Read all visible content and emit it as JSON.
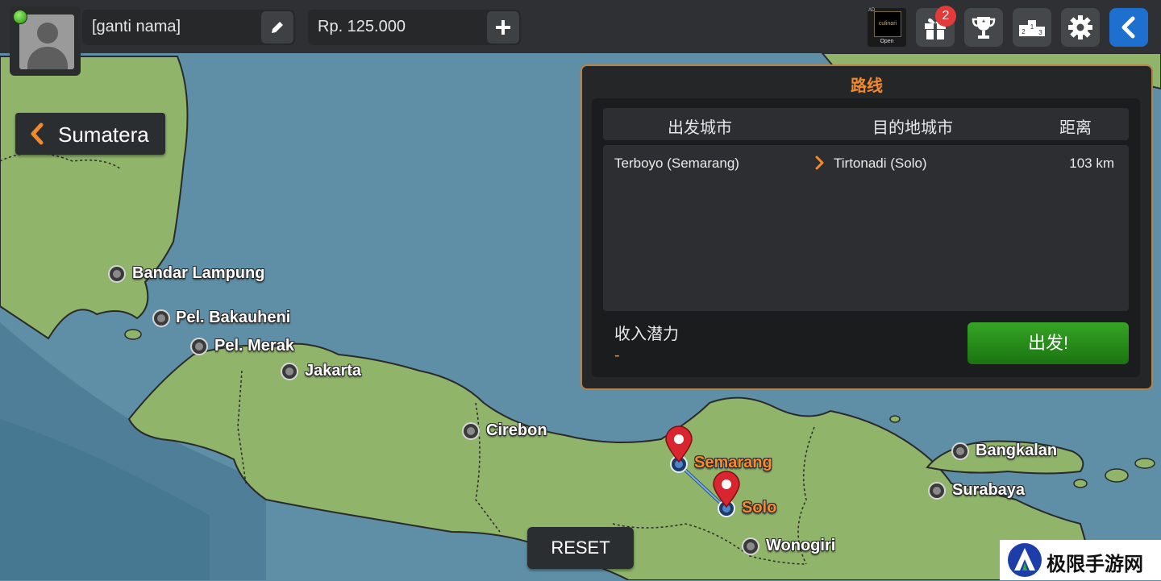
{
  "player": {
    "name": "[ganti nama]",
    "money": "Rp. 125.000",
    "online_color": "#4fbf24"
  },
  "toolbar": {
    "ad_tag": "AD",
    "ad_label": "culinari",
    "ad_open": "Open",
    "gift_badge": "2",
    "icons": [
      "edit-icon",
      "plus-icon",
      "gift-icon",
      "trophy-icon",
      "leaderboard-icon",
      "gear-icon",
      "back-icon"
    ]
  },
  "region": {
    "label": "Sumatera"
  },
  "route_panel": {
    "title": "路线",
    "headers": {
      "from": "出发城市",
      "to": "目的地城市",
      "distance": "距离"
    },
    "routes": [
      {
        "from": "Terboyo (Semarang)",
        "to": "Tirtonadi (Solo)",
        "distance": "103 km"
      }
    ],
    "income_label": "收入潜力",
    "income_value": "-",
    "go_label": "出发!"
  },
  "reset_label": "RESET",
  "cities": [
    {
      "name": "Bandar Lampung",
      "selected": false
    },
    {
      "name": "Pel. Bakauheni",
      "selected": false
    },
    {
      "name": "Pel. Merak",
      "selected": false
    },
    {
      "name": "Jakarta",
      "selected": false
    },
    {
      "name": "Cirebon",
      "selected": false
    },
    {
      "name": "Semarang",
      "selected": true
    },
    {
      "name": "Solo",
      "selected": true
    },
    {
      "name": "Wonogiri",
      "selected": false
    },
    {
      "name": "Bangkalan",
      "selected": false
    },
    {
      "name": "Surabaya",
      "selected": false
    }
  ],
  "watermark": {
    "text": "极限手游网"
  },
  "colors": {
    "accent": "#f08a2a",
    "go": "#2a9a1e",
    "back": "#1d6fd0",
    "land": "#8fb46a",
    "sea": "#5f8fa6",
    "pin": "#d8252f"
  }
}
